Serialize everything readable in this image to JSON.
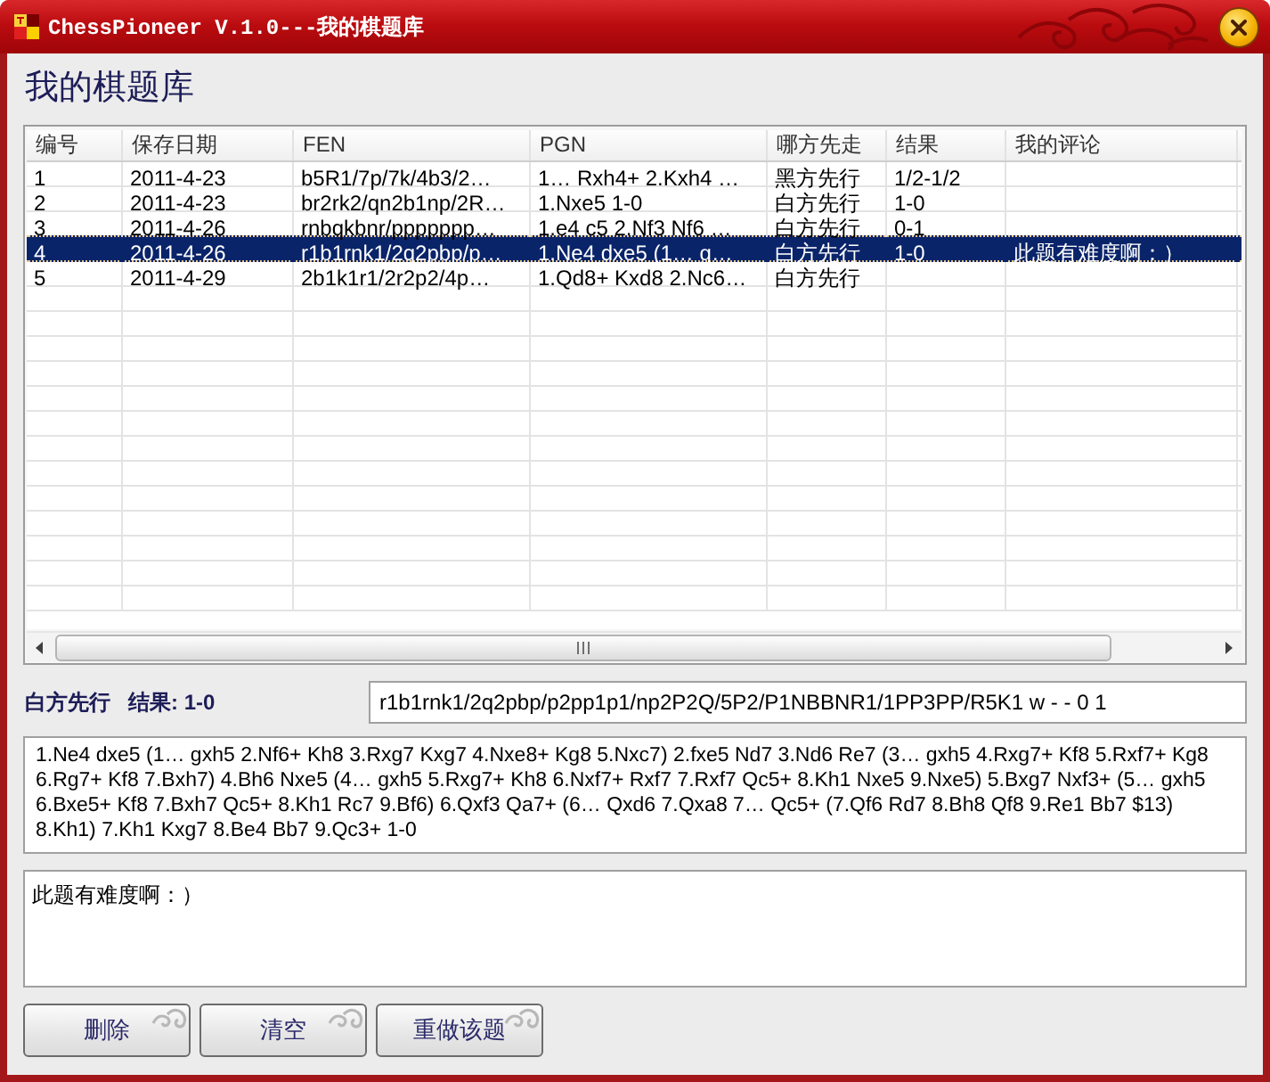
{
  "window": {
    "title": "ChessPioneer V.1.0---我的棋题库"
  },
  "heading": "我的棋题库",
  "table": {
    "columns": [
      "编号",
      "保存日期",
      "FEN",
      "PGN",
      "哪方先走",
      "结果",
      "我的评论"
    ],
    "rows": [
      {
        "no": "1",
        "date": "2011-4-23",
        "fen": "b5R1/7p/7k/4b3/2…",
        "pgn": "1… Rxh4+ 2.Kxh4 …",
        "to_move": "黑方先行",
        "result": "1/2-1/2",
        "selected": false
      },
      {
        "no": "2",
        "date": "2011-4-23",
        "fen": "br2rk2/qn2b1np/2R…",
        "pgn": "1.Nxe5 1-0",
        "to_move": "白方先行",
        "result": "1-0",
        "selected": false
      },
      {
        "no": "3",
        "date": "2011-4-26",
        "fen": "rnbqkbnr/ppppppp…",
        "pgn": "1.e4 c5 2.Nf3 Nf6 …",
        "to_move": "白方先行",
        "result": "0-1",
        "selected": false
      },
      {
        "no": "4",
        "date": "2011-4-26",
        "fen": "r1b1rnk1/2q2pbp/p…",
        "pgn": "1.Ne4 dxe5 (1… g…",
        "to_move": "白方先行",
        "result": "1-0",
        "comment": "此题有难度啊：）",
        "selected": true
      },
      {
        "no": "5",
        "date": "2011-4-29",
        "fen": "2b1k1r1/2r2p2/4p…",
        "pgn": "1.Qd8+ Kxd8 2.Nc6…",
        "to_move": "白方先行",
        "selected": false
      }
    ]
  },
  "summary": {
    "to_move": "白方先行",
    "result": "结果: 1-0"
  },
  "fen_field": {
    "value": "r1b1rnk1/2q2pbp/p2pp1p1/np2P2Q/5P2/P1NBBNR1/1PP3PP/R5K1 w - - 0 1"
  },
  "pgn_area": {
    "value": "1.Ne4 dxe5 (1… gxh5 2.Nf6+ Kh8 3.Rxg7 Kxg7 4.Nxe8+ Kg8 5.Nxc7) 2.fxe5 Nd7 3.Nd6 Re7 (3… gxh5 4.Rxg7+ Kf8 5.Rxf7+ Kg8 6.Rg7+ Kf8 7.Bxh7) 4.Bh6 Nxe5 (4… gxh5 5.Rxg7+ Kh8 6.Nxf7+ Rxf7 7.Rxf7 Qc5+ 8.Kh1 Nxe5 9.Nxe5) 5.Bxg7 Nxf3+ (5… gxh5 6.Bxe5+ Kf8 7.Bxh7 Qc5+ 8.Kh1 Rc7 9.Bf6) 6.Qxf3 Qa7+ (6… Qxd6 7.Qxa8 7… Qc5+ (7.Qf6 Rd7 8.Bh8 Qf8 9.Re1 Bb7 $13) 8.Kh1) 7.Kh1 Kxg7 8.Be4 Bb7 9.Qc3+ 1-0"
  },
  "comment_field": {
    "value": "此题有难度啊：）"
  },
  "buttons": [
    {
      "label": "删除"
    },
    {
      "label": "清空"
    },
    {
      "label": "重做该题"
    }
  ]
}
